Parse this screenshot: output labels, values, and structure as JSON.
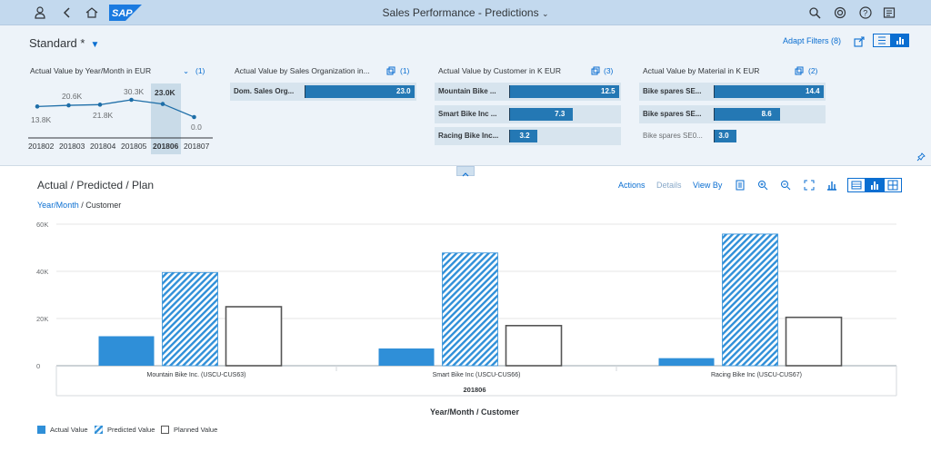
{
  "shell": {
    "title": "Sales Performance - Predictions",
    "logo": "SAP"
  },
  "header": {
    "variant": "Standard *",
    "adapt_filters": "Adapt Filters (8)",
    "cards": [
      {
        "title": "Actual Value by Year/Month in EUR",
        "count": "(1)"
      },
      {
        "title": "Actual Value by Sales Organization in...",
        "count": "(1)"
      },
      {
        "title": "Actual Value by Customer in K EUR",
        "count": "(3)"
      },
      {
        "title": "Actual Value by Material in K EUR",
        "count": "(2)"
      }
    ],
    "line_card": {
      "points": [
        {
          "x": "201802",
          "label": "13.8K"
        },
        {
          "x": "201803",
          "label": "20.6K"
        },
        {
          "x": "201804",
          "label": "21.8K"
        },
        {
          "x": "201805",
          "label": "30.3K"
        },
        {
          "x": "201806",
          "label": "23.0K",
          "selected": true
        },
        {
          "x": "201807",
          "label": "0.0"
        }
      ]
    },
    "sales_org_card": {
      "rows": [
        {
          "label": "Dom. Sales Org...",
          "value": "23.0",
          "fraction": 1.0
        }
      ]
    },
    "customer_card": {
      "rows": [
        {
          "label": "Mountain Bike ...",
          "value": "12.5",
          "fraction": 1.0
        },
        {
          "label": "Smart Bike Inc ...",
          "value": "7.3",
          "fraction": 0.58
        },
        {
          "label": "Racing Bike Inc...",
          "value": "3.2",
          "fraction": 0.26
        }
      ]
    },
    "material_card": {
      "rows": [
        {
          "label": "Bike spares SE...",
          "value": "14.4",
          "fraction": 1.0,
          "selected": true
        },
        {
          "label": "Bike spares SE...",
          "value": "8.6",
          "fraction": 0.6,
          "selected": true
        },
        {
          "label": "Bike spares SE0...",
          "value": "3.0",
          "fraction": 0.21,
          "selected": false
        }
      ]
    }
  },
  "main": {
    "title": "Actual / Predicted / Plan",
    "breadcrumb_link": "Year/Month",
    "breadcrumb_rest": " / Customer",
    "toolbar": {
      "actions": "Actions",
      "details": "Details",
      "view_by": "View By"
    }
  },
  "chart_data": {
    "type": "bar",
    "categories": [
      "Mountain Bike Inc. (USCU-CUS63)",
      "Smart Bike Inc (USCU-CUS66)",
      "Racing Bike Inc (USCU-CUS67)"
    ],
    "group_label": "201806",
    "xlabel": "Year/Month / Customer",
    "ylim": [
      0,
      60000
    ],
    "yticks": [
      "0",
      "20K",
      "40K",
      "60K"
    ],
    "series": [
      {
        "name": "Actual Value",
        "values": [
          12500,
          7300,
          3200
        ],
        "style": "solid",
        "color": "#2f8fd8"
      },
      {
        "name": "Predicted Value",
        "values": [
          39500,
          47800,
          55800
        ],
        "style": "hatched",
        "color": "#2f8fd8"
      },
      {
        "name": "Planned Value",
        "values": [
          25000,
          17000,
          20500
        ],
        "style": "outline",
        "color": "#555555"
      }
    ],
    "grid": true,
    "legend_position": "bottom-left"
  }
}
